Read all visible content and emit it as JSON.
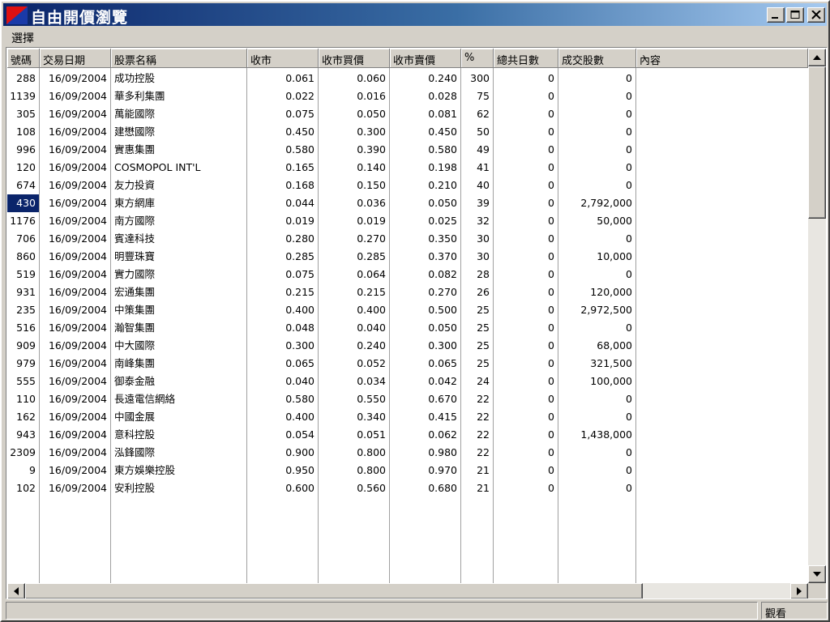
{
  "window": {
    "title": "自由開價瀏覽"
  },
  "menu": {
    "items": [
      "選擇"
    ]
  },
  "table": {
    "columns": [
      "號碼",
      "交易日期",
      "股票名稱",
      "收市",
      "收市買價",
      "收市賣價",
      "%",
      "總共日數",
      "成交股數",
      "內容"
    ],
    "rows": [
      [
        "288",
        "16/09/2004",
        "成功控股",
        "0.061",
        "0.060",
        "0.240",
        "300",
        "0",
        "0",
        ""
      ],
      [
        "1139",
        "16/09/2004",
        "華多利集團",
        "0.022",
        "0.016",
        "0.028",
        "75",
        "0",
        "0",
        ""
      ],
      [
        "305",
        "16/09/2004",
        "萬能國際",
        "0.075",
        "0.050",
        "0.081",
        "62",
        "0",
        "0",
        ""
      ],
      [
        "108",
        "16/09/2004",
        "建懋國際",
        "0.450",
        "0.300",
        "0.450",
        "50",
        "0",
        "0",
        ""
      ],
      [
        "996",
        "16/09/2004",
        "實惠集團",
        "0.580",
        "0.390",
        "0.580",
        "49",
        "0",
        "0",
        ""
      ],
      [
        "120",
        "16/09/2004",
        "COSMOPOL INT'L",
        "0.165",
        "0.140",
        "0.198",
        "41",
        "0",
        "0",
        ""
      ],
      [
        "674",
        "16/09/2004",
        "友力投資",
        "0.168",
        "0.150",
        "0.210",
        "40",
        "0",
        "0",
        ""
      ],
      [
        "430",
        "16/09/2004",
        "東方網庫",
        "0.044",
        "0.036",
        "0.050",
        "39",
        "0",
        "2,792,000",
        ""
      ],
      [
        "1176",
        "16/09/2004",
        "南方國際",
        "0.019",
        "0.019",
        "0.025",
        "32",
        "0",
        "50,000",
        ""
      ],
      [
        "706",
        "16/09/2004",
        "賓達科技",
        "0.280",
        "0.270",
        "0.350",
        "30",
        "0",
        "0",
        ""
      ],
      [
        "860",
        "16/09/2004",
        "明豐珠寶",
        "0.285",
        "0.285",
        "0.370",
        "30",
        "0",
        "10,000",
        ""
      ],
      [
        "519",
        "16/09/2004",
        "實力國際",
        "0.075",
        "0.064",
        "0.082",
        "28",
        "0",
        "0",
        ""
      ],
      [
        "931",
        "16/09/2004",
        "宏通集團",
        "0.215",
        "0.215",
        "0.270",
        "26",
        "0",
        "120,000",
        ""
      ],
      [
        "235",
        "16/09/2004",
        "中策集團",
        "0.400",
        "0.400",
        "0.500",
        "25",
        "0",
        "2,972,500",
        ""
      ],
      [
        "516",
        "16/09/2004",
        "瀚智集團",
        "0.048",
        "0.040",
        "0.050",
        "25",
        "0",
        "0",
        ""
      ],
      [
        "909",
        "16/09/2004",
        "中大國際",
        "0.300",
        "0.240",
        "0.300",
        "25",
        "0",
        "68,000",
        ""
      ],
      [
        "979",
        "16/09/2004",
        "南峰集團",
        "0.065",
        "0.052",
        "0.065",
        "25",
        "0",
        "321,500",
        ""
      ],
      [
        "555",
        "16/09/2004",
        "御泰金融",
        "0.040",
        "0.034",
        "0.042",
        "24",
        "0",
        "100,000",
        ""
      ],
      [
        "110",
        "16/09/2004",
        "長遠電信網絡",
        "0.580",
        "0.550",
        "0.670",
        "22",
        "0",
        "0",
        ""
      ],
      [
        "162",
        "16/09/2004",
        "中國金展",
        "0.400",
        "0.340",
        "0.415",
        "22",
        "0",
        "0",
        ""
      ],
      [
        "943",
        "16/09/2004",
        "意科控股",
        "0.054",
        "0.051",
        "0.062",
        "22",
        "0",
        "1,438,000",
        ""
      ],
      [
        "2309",
        "16/09/2004",
        "泓鋒國際",
        "0.900",
        "0.800",
        "0.980",
        "22",
        "0",
        "0",
        ""
      ],
      [
        "9",
        "16/09/2004",
        "東方娛樂控股",
        "0.950",
        "0.800",
        "0.970",
        "21",
        "0",
        "0",
        ""
      ],
      [
        "102",
        "16/09/2004",
        "安利控股",
        "0.600",
        "0.560",
        "0.680",
        "21",
        "0",
        "0",
        ""
      ]
    ],
    "selected_row": 7
  },
  "statusbar": {
    "left": "",
    "right": "觀看"
  }
}
